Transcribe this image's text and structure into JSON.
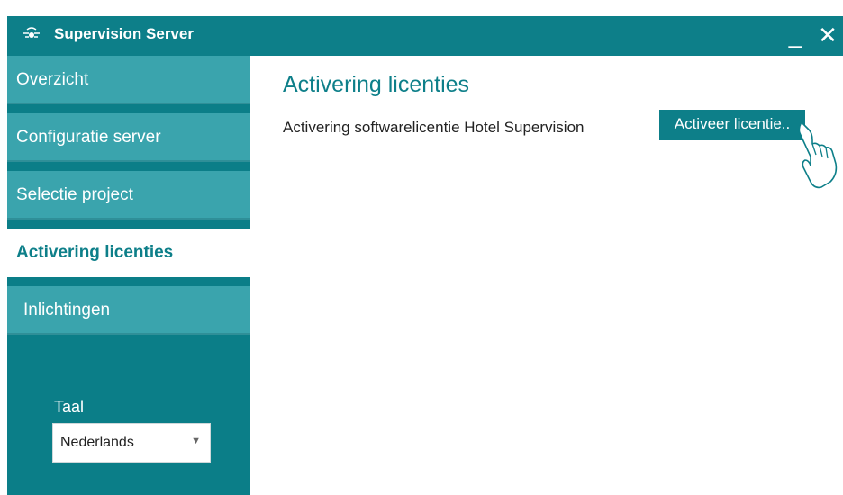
{
  "window": {
    "title": "Supervision Server",
    "minimize_glyph": "_",
    "close_glyph": "✕",
    "accent_color": "#0d7f89"
  },
  "sidebar": {
    "items": [
      {
        "label": "Overzicht",
        "active": false
      },
      {
        "label": "Configuratie server",
        "active": false
      },
      {
        "label": "Selectie project",
        "active": false
      },
      {
        "label": "Activering licenties",
        "active": true
      },
      {
        "label": "Inlichtingen",
        "active": false
      }
    ],
    "language": {
      "label": "Taal",
      "selected": "Nederlands"
    }
  },
  "main": {
    "title": "Activering licenties",
    "description": "Activering softwarelicentie Hotel Supervision",
    "activate_button": "Activeer licentie.."
  },
  "icons": {
    "app": "server-connection-icon",
    "pointer": "hand-pointer-icon"
  }
}
